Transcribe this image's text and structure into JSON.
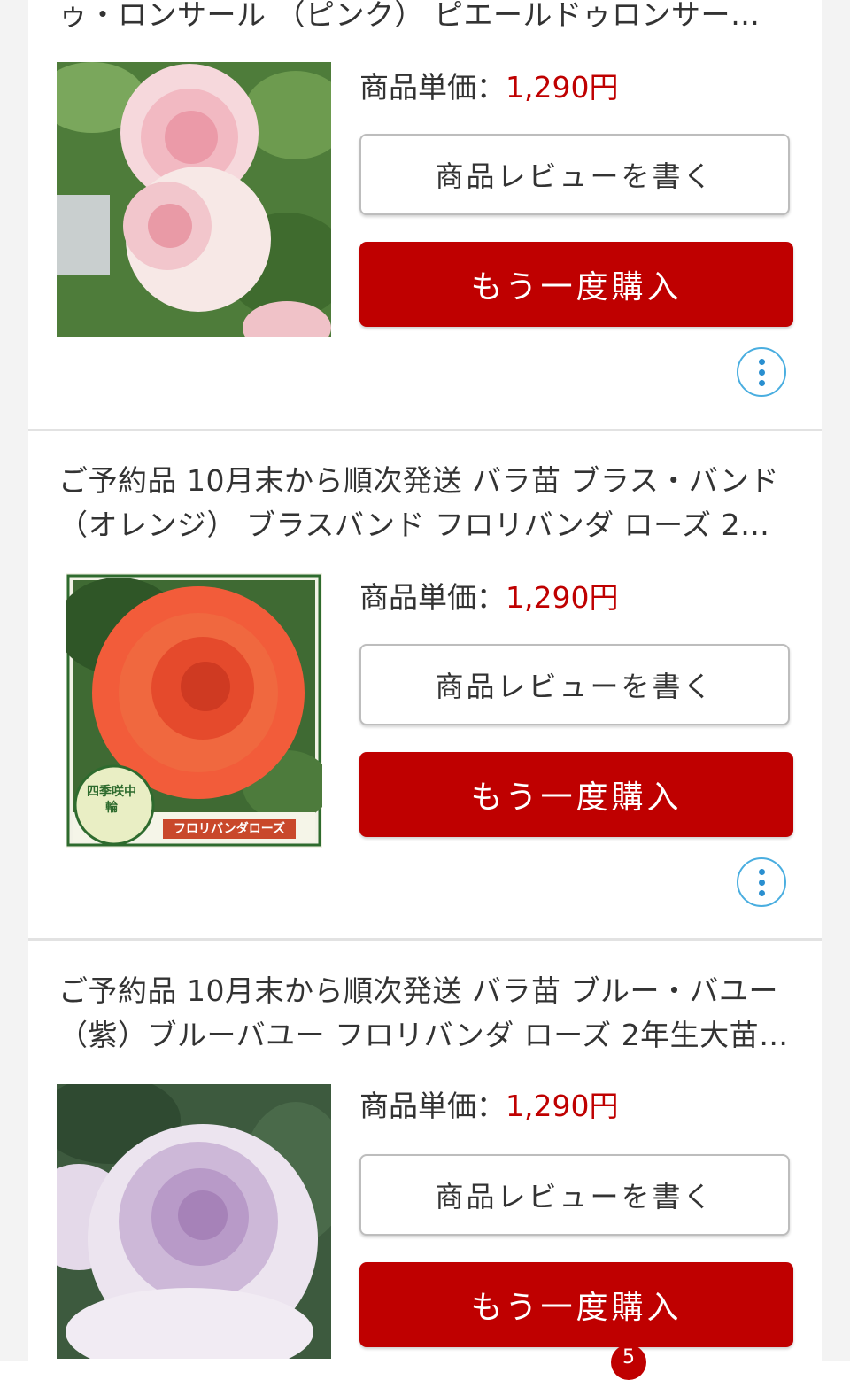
{
  "items": [
    {
      "title": "ゥ・ロンサール （ピンク） ピエールドゥロンサー…",
      "image_alt": "pink-rose-photo",
      "price_label": "商品単価：",
      "price": "1,290円",
      "review_label": "商品レビューを書く",
      "buy_again_label": "もう一度購入"
    },
    {
      "title": "ご予約品 10月末から順次発送 バラ苗 ブラス・バンド（オレンジ） ブラスバンド フロリバンダ ローズ 2…",
      "image_alt": "orange-rose-photo",
      "image_badge_text": "四季咲中輪",
      "image_caption_text": "フロリバンダローズ",
      "price_label": "商品単価：",
      "price": "1,290円",
      "review_label": "商品レビューを書く",
      "buy_again_label": "もう一度購入"
    },
    {
      "title": "ご予約品 10月末から順次発送 バラ苗 ブルー・バユー（紫）ブルーバユー フロリバンダ ローズ 2年生大苗…",
      "image_alt": "purple-rose-photo",
      "price_label": "商品単価：",
      "price": "1,290円",
      "review_label": "商品レビューを書く",
      "buy_again_label": "もう一度購入"
    }
  ],
  "colors": {
    "accent_red": "#bf0000",
    "more_button_blue": "#2a8fd0",
    "divider": "#e2e2e2"
  },
  "bottom_badge": "5"
}
